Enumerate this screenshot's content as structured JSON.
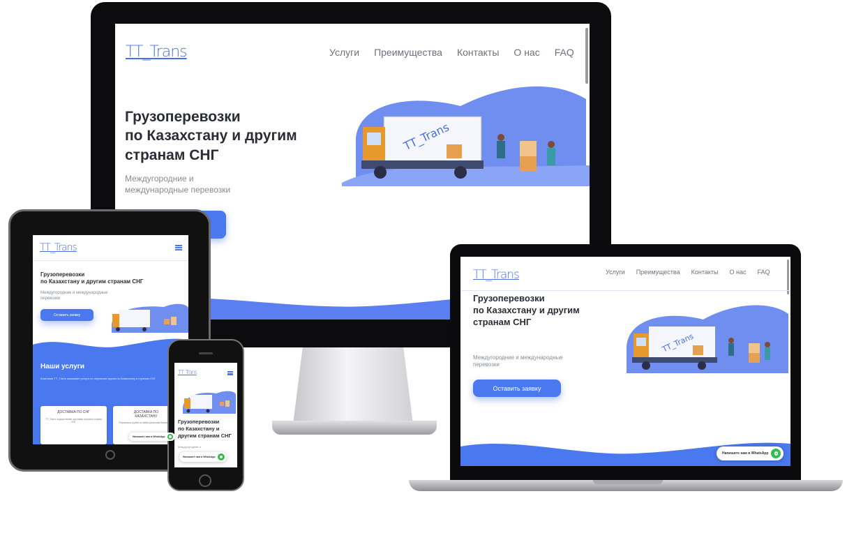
{
  "brand": {
    "logo": "TT_Trans"
  },
  "nav": {
    "items": [
      "Услуги",
      "Преимущества",
      "Контакты",
      "О нас",
      "FAQ"
    ]
  },
  "hero": {
    "title_line1": "Грузоперевозки",
    "title_line2": "по Казахстану и другим",
    "title_line3": "странам СНГ",
    "title_tablet_line2": "по Казахстану и другим странам СНГ",
    "title_phone_line2": "по Казахстану и",
    "title_phone_line3": "другим странам СНГ",
    "subtitle_line1": "Междугородние и",
    "subtitle_line2": "международные перевозки",
    "subtitle_laptop_line1": "Междугородние и международные",
    "subtitle_laptop_line2": "перевозки",
    "subtitle_tablet_line1": "Междугородние и международные",
    "subtitle_tablet_line2": "перевозки",
    "subtitle_phone": "Междугородние и",
    "cta": "Оставить заявку"
  },
  "services": {
    "title": "Наши услуги",
    "intro": "Компания TT_Trans оказывает услуги по перевозке грузов по Казахстану и странам СНГ",
    "card1_title": "ДОСТАВКА ПО СНГ",
    "card1_text": "TT_Trans осуществляет доставку грузов в страны СНГ",
    "card2_title_line1": "ДОСТАВКА ПО",
    "card2_title_line2": "КАЗАХСТАНУ",
    "card2_text": "Перевозка грузов по всем регионам Казахстана"
  },
  "chat": {
    "label": "Напишите нам в WhatsApp"
  },
  "colors": {
    "accent": "#4a78ee",
    "logo": "#4a6fe0",
    "wave": "#5b7ff0",
    "whatsapp": "#2fbf4a"
  },
  "icons": [
    "menu-icon",
    "whatsapp-icon",
    "truck-illustration"
  ]
}
